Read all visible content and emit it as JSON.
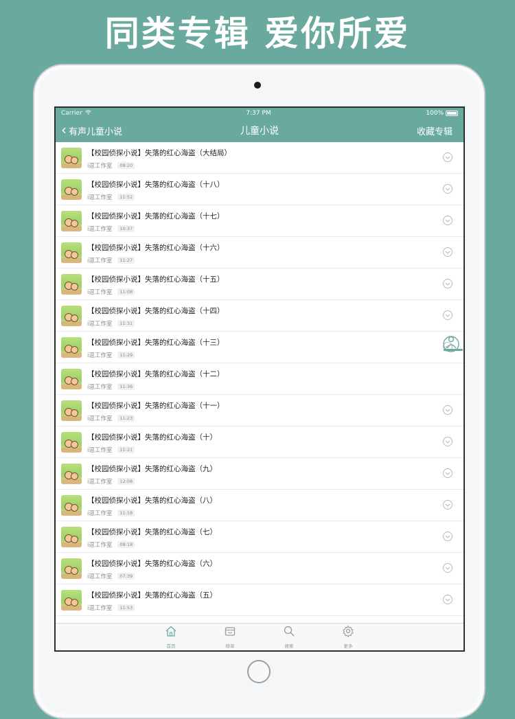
{
  "headline": "同类专辑 爱你所爱",
  "status_bar": {
    "carrier": "Carrier",
    "time": "7:37 PM",
    "battery": "100%"
  },
  "nav": {
    "back_label": "有声儿童小说",
    "title": "儿童小说",
    "right_label": "收藏专辑"
  },
  "episodes": [
    {
      "title": "【校园侦探小说】失落的红心海盗（大结局）",
      "author": "i逗工作室",
      "duration": "08:20"
    },
    {
      "title": "【校园侦探小说】失落的红心海盗（十八）",
      "author": "i逗工作室",
      "duration": "11:52"
    },
    {
      "title": "【校园侦探小说】失落的红心海盗（十七）",
      "author": "i逗工作室",
      "duration": "10:37"
    },
    {
      "title": "【校园侦探小说】失落的红心海盗（十六）",
      "author": "i逗工作室",
      "duration": "11:27"
    },
    {
      "title": "【校园侦探小说】失落的红心海盗（十五）",
      "author": "i逗工作室",
      "duration": "11:08"
    },
    {
      "title": "【校园侦探小说】失落的红心海盗（十四）",
      "author": "i逗工作室",
      "duration": "11:31"
    },
    {
      "title": "【校园侦探小说】失落的红心海盗（十三）",
      "author": "i逗工作室",
      "duration": "11:29"
    },
    {
      "title": "【校园侦探小说】失落的红心海盗（十二）",
      "author": "i逗工作室",
      "duration": "11:36"
    },
    {
      "title": "【校园侦探小说】失落的红心海盗（十一）",
      "author": "i逗工作室",
      "duration": "11:23"
    },
    {
      "title": "【校园侦探小说】失落的红心海盗（十）",
      "author": "i逗工作室",
      "duration": "11:21"
    },
    {
      "title": "【校园侦探小说】失落的红心海盗（九）",
      "author": "i逗工作室",
      "duration": "12:08"
    },
    {
      "title": "【校园侦探小说】失落的红心海盗（八）",
      "author": "i逗工作室",
      "duration": "11:18"
    },
    {
      "title": "【校园侦探小说】失落的红心海盗（七）",
      "author": "i逗工作室",
      "duration": "08:18"
    },
    {
      "title": "【校园侦探小说】失落的红心海盗（六）",
      "author": "i逗工作室",
      "duration": "07:39"
    },
    {
      "title": "【校园侦探小说】失落的红心海盗（五）",
      "author": "i逗工作室",
      "duration": "11:53"
    }
  ],
  "tabs": [
    {
      "label": "首页",
      "icon": "home-icon",
      "active": true
    },
    {
      "label": "榜单",
      "icon": "chart-box-icon",
      "active": false
    },
    {
      "label": "搜索",
      "icon": "search-icon",
      "active": false
    },
    {
      "label": "更多",
      "icon": "gear-icon",
      "active": false
    }
  ],
  "colors": {
    "accent": "#6aaa9e",
    "background": "#6aaa9e",
    "icon_gray": "#b9b9b9"
  }
}
